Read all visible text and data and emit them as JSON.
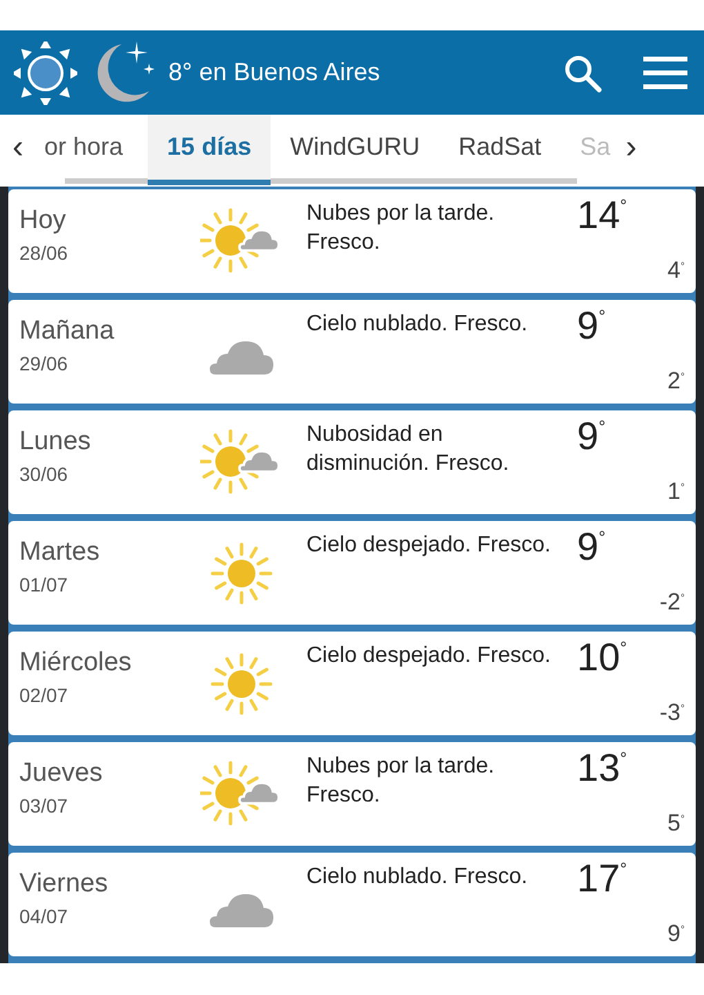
{
  "header": {
    "title": "8° en Buenos Aires"
  },
  "tabs": {
    "prev": "‹",
    "next": "›",
    "items": [
      {
        "label": "or hora",
        "selected": false
      },
      {
        "label": "15 días",
        "selected": true
      },
      {
        "label": "WindGURU",
        "selected": false
      },
      {
        "label": "RadSat",
        "selected": false
      },
      {
        "label": "Sa",
        "selected": false
      }
    ]
  },
  "days": [
    {
      "day": "Hoy",
      "date": "28/06",
      "kind": "sun-cloud",
      "description": "Nubes por la tarde. Fresco.",
      "high": "14$^{°}$",
      "low": "4$^{°}$"
    },
    {
      "day": "Mañana",
      "date": "29/06",
      "kind": "cloud",
      "description": "Cielo nublado. Fresco.",
      "high": "9$^{°}$",
      "low": "2$^{°}$"
    },
    {
      "day": "Lunes",
      "date": "30/06",
      "kind": "sun-cloud",
      "description": "Nubosidad en disminución. Fresco.",
      "high": "9$^{°}$",
      "low": "1$^{°}$"
    },
    {
      "day": "Martes",
      "date": "01/07",
      "kind": "sun",
      "description": "Cielo despejado. Fresco.",
      "high": "9$^{°}$",
      "low": "-2$^{°}$"
    },
    {
      "day": "Miércoles",
      "date": "02/07",
      "kind": "sun",
      "description": "Cielo despejado. Fresco.",
      "high": "10$^{°}$",
      "low": "-3$^{°}$"
    },
    {
      "day": "Jueves",
      "date": "03/07",
      "kind": "sun-cloud",
      "description": "Nubes por la tarde. Fresco.",
      "high": "13$^{°}$",
      "low": "5$^{°}$"
    },
    {
      "day": "Viernes",
      "date": "04/07",
      "kind": "cloud",
      "description": "Cielo nublado. Fresco.",
      "high": "17$^{°}$",
      "low": "9$^{°}$"
    }
  ]
}
